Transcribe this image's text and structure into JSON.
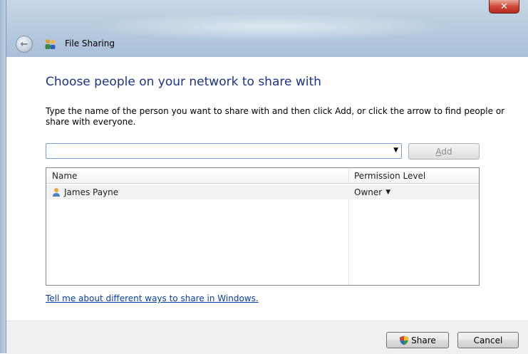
{
  "window": {
    "title": "File Sharing",
    "close_glyph": "✕",
    "back_glyph": "←"
  },
  "main": {
    "heading": "Choose people on your network to share with",
    "instructions": "Type the name of the person you want to share with and then click Add, or click the arrow to find people or share with everyone.",
    "name_input": {
      "value": "",
      "placeholder": ""
    },
    "add_label": "Add"
  },
  "list": {
    "columns": [
      "Name",
      "Permission Level"
    ],
    "rows": [
      {
        "name": "James Payne",
        "permission": "Owner"
      }
    ]
  },
  "help_link": "Tell me about different ways to share in Windows.",
  "footer": {
    "share_label": "Share",
    "cancel_label": "Cancel"
  },
  "icons": {
    "app": "people-sharing-icon",
    "user": "user-icon",
    "shield": "uac-shield-icon"
  },
  "colors": {
    "heading": "#1e3287",
    "link": "#0a3ea8",
    "close": "#d1493a"
  }
}
